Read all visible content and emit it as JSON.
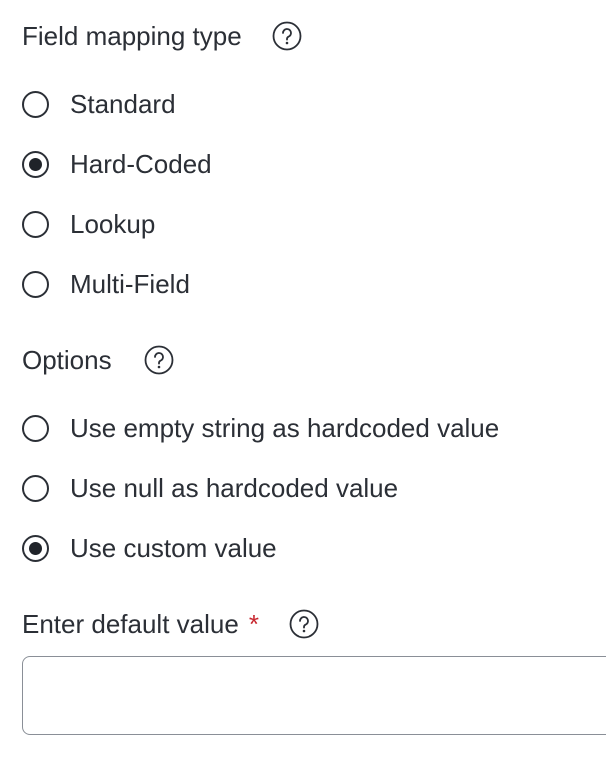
{
  "field_mapping": {
    "label": "Field mapping type",
    "help_icon": "question-circle-icon",
    "options": [
      {
        "label": "Standard",
        "checked": false
      },
      {
        "label": "Hard-Coded",
        "checked": true
      },
      {
        "label": "Lookup",
        "checked": false
      },
      {
        "label": "Multi-Field",
        "checked": false
      }
    ]
  },
  "options_section": {
    "label": "Options",
    "help_icon": "question-circle-icon",
    "options": [
      {
        "label": "Use empty string as hardcoded value",
        "checked": false
      },
      {
        "label": "Use null as hardcoded value",
        "checked": false
      },
      {
        "label": "Use custom value",
        "checked": true
      }
    ]
  },
  "default_value": {
    "label": "Enter default value",
    "required_marker": "*",
    "help_icon": "question-circle-icon",
    "value": "",
    "placeholder": ""
  },
  "colors": {
    "text": "#2b2f36",
    "required": "#c8272f",
    "border": "#8a8f97"
  }
}
